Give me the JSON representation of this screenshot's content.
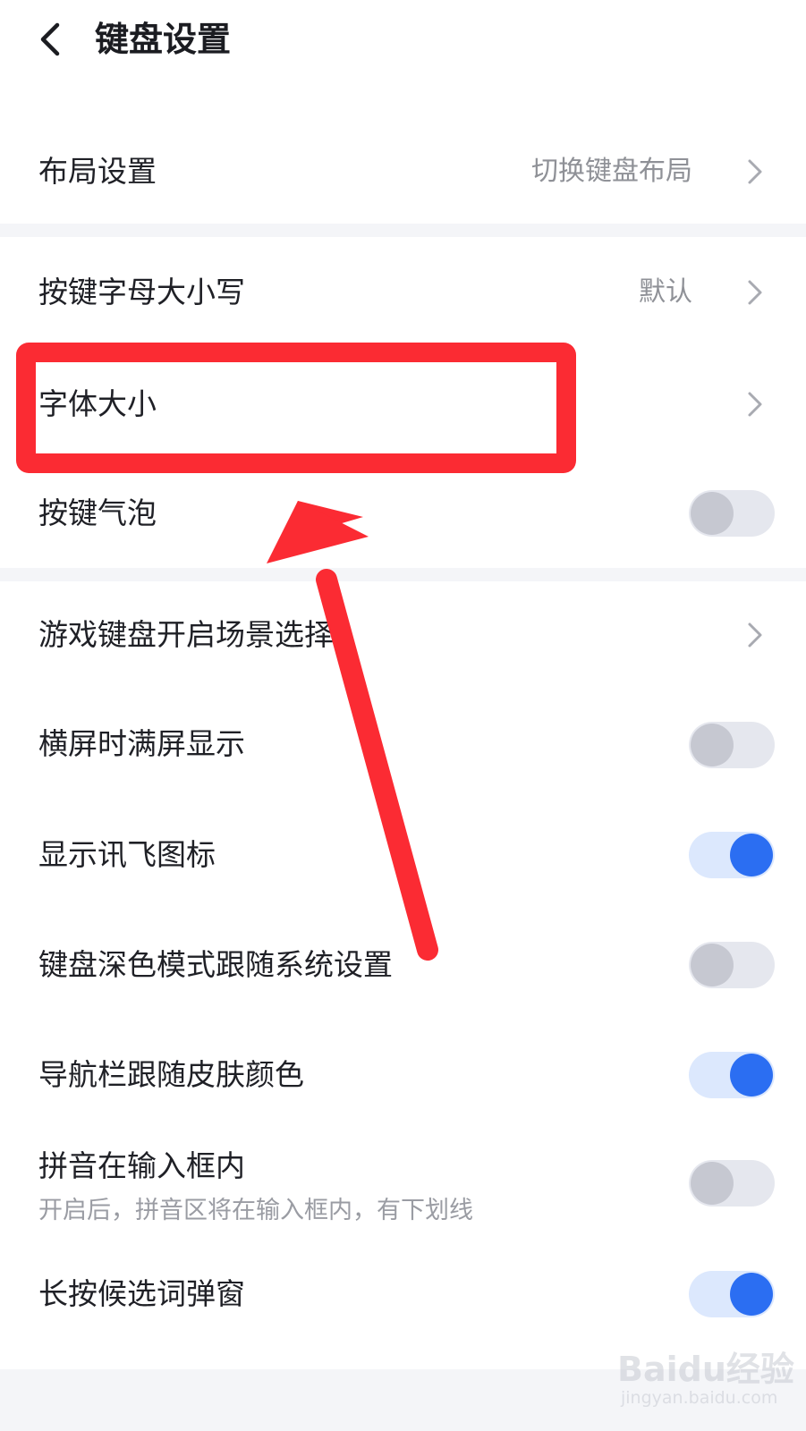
{
  "header": {
    "title": "键盘设置",
    "back_icon": "chevron-left-icon"
  },
  "sections": [
    {
      "rows": [
        {
          "label": "布局设置",
          "value": "切换键盘布局",
          "control": "chevron"
        }
      ]
    },
    {
      "rows": [
        {
          "label": "按键字母大小写",
          "value": "默认",
          "control": "chevron"
        },
        {
          "label": "字体大小",
          "control": "chevron"
        },
        {
          "label": "按键气泡",
          "control": "toggle",
          "checked": false
        }
      ]
    },
    {
      "rows": [
        {
          "label": "游戏键盘开启场景选择",
          "control": "chevron"
        },
        {
          "label": "横屏时满屏显示",
          "control": "toggle",
          "checked": false
        },
        {
          "label": "显示讯飞图标",
          "control": "toggle",
          "checked": true
        },
        {
          "label": "键盘深色模式跟随系统设置",
          "control": "toggle",
          "checked": false
        },
        {
          "label": "导航栏跟随皮肤颜色",
          "control": "toggle",
          "checked": true
        },
        {
          "label": "拼音在输入框内",
          "sub": "开启后，拼音区将在输入框内，有下划线",
          "control": "toggle",
          "checked": false
        },
        {
          "label": "长按候选词弹窗",
          "control": "toggle",
          "checked": true
        }
      ]
    }
  ],
  "watermark": {
    "logo": "Baidu经验",
    "url": "jingyan.baidu.com"
  },
  "colors": {
    "accent": "#2b6ef2",
    "annotation": "#fb2b33",
    "separator": "#f4f5f8"
  }
}
